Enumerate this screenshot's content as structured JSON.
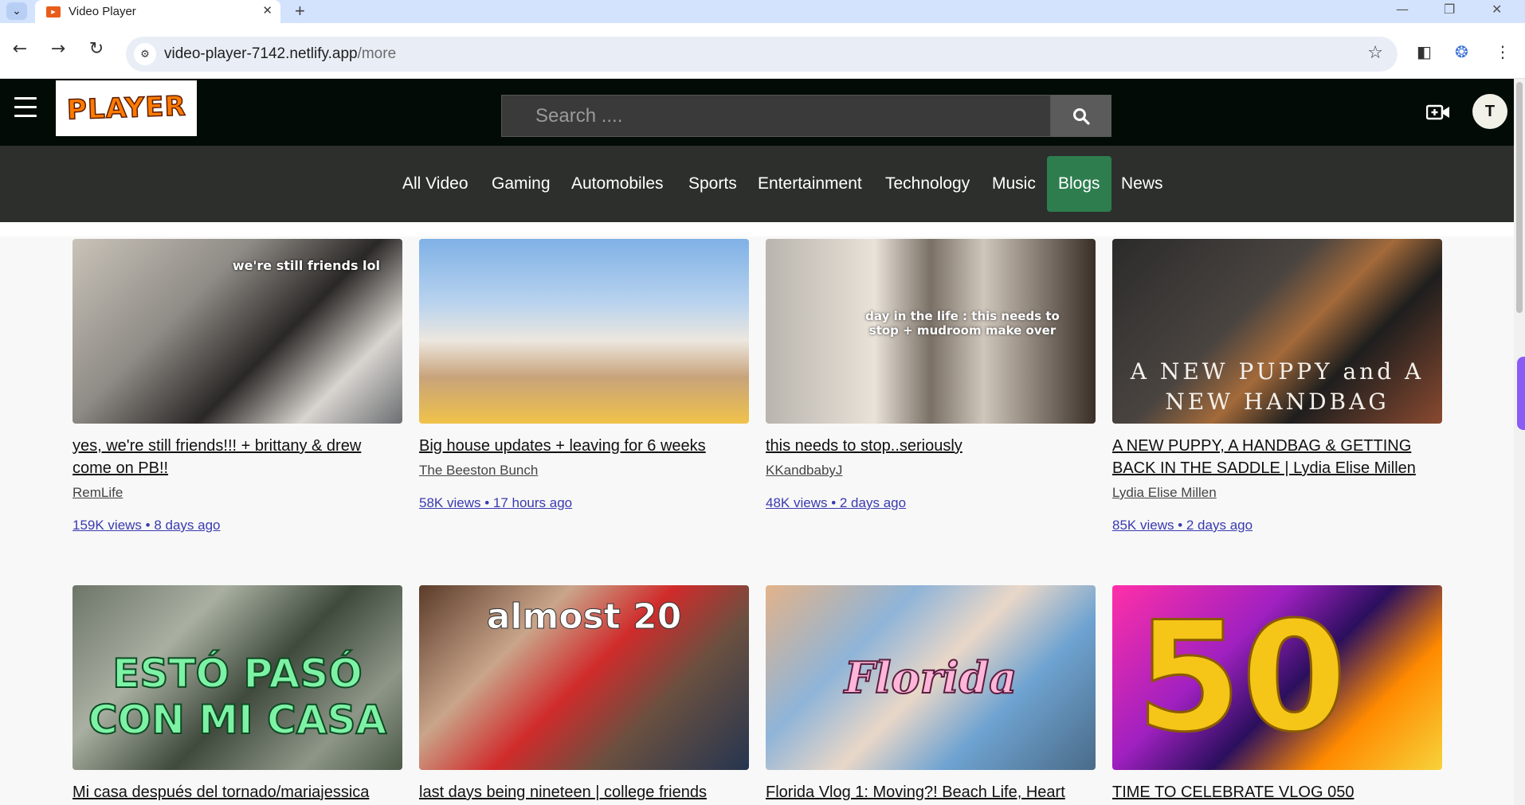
{
  "browser": {
    "tab_title": "Video Player",
    "url_host": "video-player-7142.netlify.app",
    "url_path": "/more"
  },
  "header": {
    "logo_text": "PLAYER",
    "search_placeholder": "Search ....",
    "avatar_initial": "T"
  },
  "categories": [
    {
      "label": "All Video"
    },
    {
      "label": "Gaming"
    },
    {
      "label": "Automobiles"
    },
    {
      "label": "Sports"
    },
    {
      "label": "Entertainment"
    },
    {
      "label": "Technology"
    },
    {
      "label": "Music"
    },
    {
      "label": "Blogs",
      "active": true
    },
    {
      "label": "News"
    }
  ],
  "videos": [
    {
      "title": "yes, we're still friends!!! + brittany & drew come on PB!!",
      "channel": "RemLife",
      "meta": "159K views • 8 days ago",
      "thumb_text": "we're still friends lol"
    },
    {
      "title": "Big house updates + leaving for 6 weeks",
      "channel": "The Beeston Bunch",
      "meta": "58K views • 17 hours ago",
      "thumb_text": ""
    },
    {
      "title": "this needs to stop..seriously",
      "channel": "KKandbabyJ",
      "meta": "48K views • 2 days ago",
      "thumb_text": "day in the life : this needs to stop + mudroom make over"
    },
    {
      "title": "A NEW PUPPY, A HANDBAG & GETTING BACK IN THE SADDLE | Lydia Elise Millen",
      "channel": "Lydia Elise Millen",
      "meta": "85K views • 2 days ago",
      "thumb_text": "A NEW PUPPY and A NEW HANDBAG"
    },
    {
      "title": "Mi casa después del tornado/mariajessica",
      "channel": "",
      "meta": "",
      "thumb_text": "ESTÓ PASÓ CON MI CASA"
    },
    {
      "title": "last days being nineteen | college friends",
      "channel": "",
      "meta": "",
      "thumb_text": "almost 20"
    },
    {
      "title": "Florida Vlog 1: Moving?! Beach Life, Heart",
      "channel": "",
      "meta": "",
      "thumb_text": "Florida"
    },
    {
      "title": "TIME TO CELEBRATE VLOG 050",
      "channel": "",
      "meta": "",
      "thumb_text": "50"
    }
  ],
  "colors": {
    "header_bg": "#020b05",
    "nav_bg": "#2d2f2d",
    "active_category": "#2e7d4f",
    "logo_orange": "#ff7a00",
    "meta_link": "#3a3ab0"
  }
}
